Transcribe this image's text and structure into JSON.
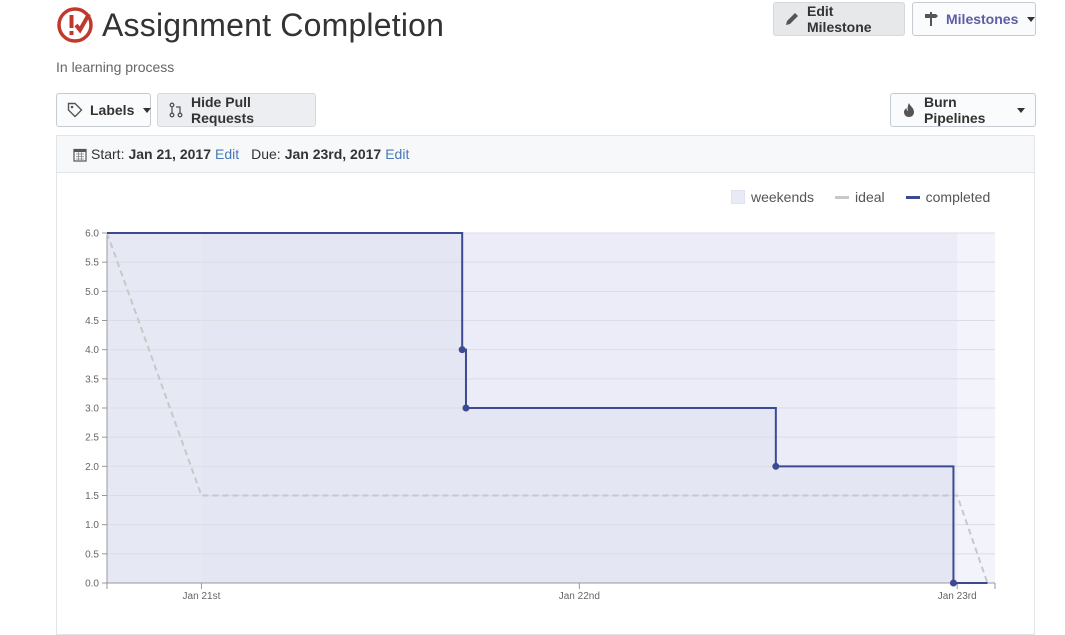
{
  "header": {
    "title": "Assignment Completion",
    "subtitle": "In learning process",
    "icon": "milestone-check-icon",
    "accent": "#c0392b"
  },
  "toolbar": {
    "edit_milestone": "Edit Milestone",
    "milestones": "Milestones",
    "labels": "Labels",
    "hide_pull_requests": "Hide Pull Requests",
    "burn_pipelines": "Burn Pipelines"
  },
  "dates": {
    "start_label": "Start:",
    "start_value": "Jan 21, 2017",
    "start_edit": "Edit",
    "due_label": "Due:",
    "due_value": "Jan 23rd, 2017",
    "due_edit": "Edit"
  },
  "legend": {
    "weekends": "weekends",
    "ideal": "ideal",
    "completed": "completed"
  },
  "colors": {
    "completed": "#3c4a94",
    "ideal": "#c8c8c8",
    "weekend_fill": "#e3e5f4",
    "plot_fill": "#f3f4fb",
    "completed_fill": "#e3e4f2"
  },
  "chart_data": {
    "type": "line",
    "title": "",
    "xlabel": "",
    "ylabel": "",
    "ylim": [
      0,
      6
    ],
    "yticks": [
      "0.0",
      "0.5",
      "1.0",
      "1.5",
      "2.0",
      "2.5",
      "3.0",
      "3.5",
      "4.0",
      "4.5",
      "5.0",
      "5.5",
      "6.0"
    ],
    "xticks": [
      {
        "label": "Jan 21st",
        "x": 0.25
      },
      {
        "label": "Jan 22nd",
        "x": 1.25
      },
      {
        "label": "Jan 23rd",
        "x": 2.25
      }
    ],
    "xlim": [
      0,
      2.35
    ],
    "weekend_ranges": [
      [
        0,
        0.25
      ],
      [
        0.25,
        2.25
      ]
    ],
    "legend_position": "top-right",
    "grid": true,
    "series": [
      {
        "name": "completed",
        "step": true,
        "points": [
          {
            "x": 0,
            "y": 6
          },
          {
            "x": 0.94,
            "y": 6
          },
          {
            "x": 0.94,
            "y": 4,
            "marker": true
          },
          {
            "x": 0.95,
            "y": 4
          },
          {
            "x": 0.95,
            "y": 3,
            "marker": true
          },
          {
            "x": 1.77,
            "y": 3
          },
          {
            "x": 1.77,
            "y": 2,
            "marker": true
          },
          {
            "x": 2.24,
            "y": 2
          },
          {
            "x": 2.24,
            "y": 0,
            "marker": true
          },
          {
            "x": 2.33,
            "y": 0
          }
        ]
      },
      {
        "name": "ideal",
        "dashed": true,
        "points": [
          {
            "x": 0,
            "y": 6
          },
          {
            "x": 0.25,
            "y": 1.5
          },
          {
            "x": 2.25,
            "y": 1.5
          },
          {
            "x": 2.33,
            "y": 0
          }
        ]
      }
    ]
  }
}
